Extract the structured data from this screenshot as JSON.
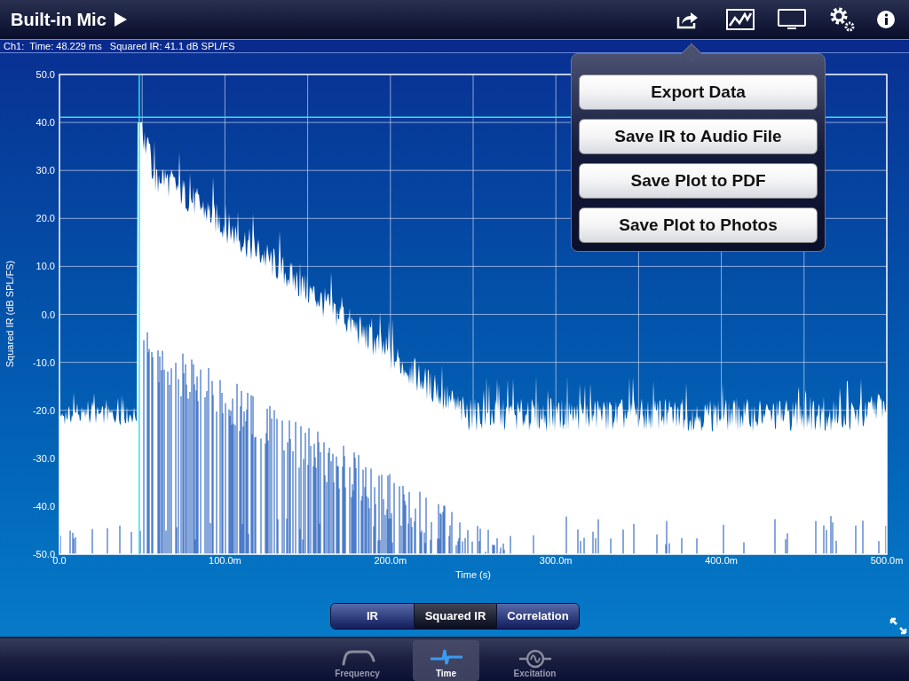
{
  "title": "Built-in Mic",
  "readout": "Ch1:  Time: 48.229 ms   Squared IR: 41.1 dB SPL/FS",
  "plot": {
    "ylabel": "Squared IR (dB SPL/FS)",
    "xlabel": "Time (s)",
    "yticks": [
      "50.0",
      "40.0",
      "30.0",
      "20.0",
      "10.0",
      "0.0",
      "-10.0",
      "-20.0",
      "-30.0",
      "-40.0",
      "-50.0"
    ],
    "xticks": [
      "0.0",
      "100.0m",
      "200.0m",
      "300.0m",
      "400.0m",
      "500.0m"
    ]
  },
  "export_menu": [
    "Export Data",
    "Save IR to Audio File",
    "Save Plot to PDF",
    "Save Plot to Photos"
  ],
  "segments": [
    {
      "label": "IR",
      "selected": false
    },
    {
      "label": "Squared IR",
      "selected": true
    },
    {
      "label": "Correlation",
      "selected": false
    }
  ],
  "tabs": [
    {
      "label": "Frequency",
      "kind": "frequency",
      "selected": false
    },
    {
      "label": "Time",
      "kind": "time",
      "selected": true
    },
    {
      "label": "Excitation",
      "kind": "excitation",
      "selected": false
    }
  ]
}
